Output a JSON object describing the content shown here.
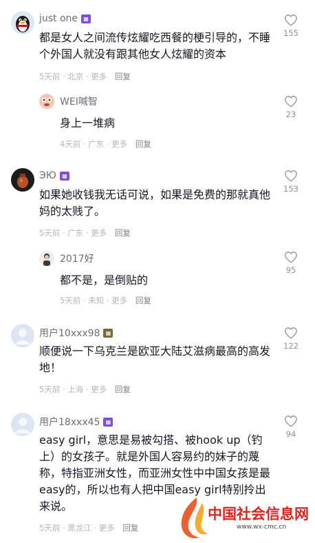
{
  "comments": [
    {
      "username": "just one",
      "badge_color": "#7b4fd6",
      "text": "都是女人之间流传炫耀吃西餐的梗引导的，不睡个外国人就没有跟其他女人炫耀的资本",
      "time": "5天前",
      "location": "北京",
      "more": "更多",
      "reply": "回复",
      "likes": "155",
      "avatar_icon": "penguin-avatar"
    },
    {
      "username": "WEI喊智",
      "text": "身上一堆病",
      "time": "4天前",
      "location": "广东",
      "more": "更多",
      "reply": "回复",
      "likes": "23",
      "avatar_icon": "cartoon-avatar"
    },
    {
      "username": "ЭЮ",
      "badge_color": "#7b4fd6",
      "text": "如果她收钱我无话可说，如果是免费的那就真他妈的太贱了。",
      "time": "5天前",
      "location": "广东",
      "more": "更多",
      "reply": "回复",
      "likes": "153",
      "avatar_icon": "jar-avatar"
    },
    {
      "username": "2017好",
      "text": "都不是，是倒贴的",
      "time": "5天前",
      "location": "未知",
      "more": "更多",
      "reply": "回复",
      "likes": "95",
      "avatar_icon": "person-avatar"
    },
    {
      "username": "用户10xxx98",
      "badge_color": "#7a6a3a",
      "text": "顺便说一下乌克兰是欧亚大陆艾滋病最高的高发地！",
      "time": "5天前",
      "location": "上海",
      "more": "更多",
      "reply": "回复",
      "likes": "122",
      "avatar_icon": "default-avatar"
    },
    {
      "username": "用户18xxx45",
      "badge_color": "#7b4fd6",
      "text": "easy girl，意思是易被勾搭、被hook up（钓上）的女孩子。就是外国人容易约的妹子的蔑称，特指亚洲女性，而亚洲女性中中国女孩是最easy的，所以也有人把中国easy girl特别拎出来说。",
      "time": "5天前",
      "location": "黑龙江",
      "more": "更多",
      "reply": "回复",
      "likes": "94",
      "avatar_icon": "default-avatar"
    }
  ],
  "watermark": {
    "title": "中国社会信息网",
    "url": "www.wx-cmc.cn"
  }
}
